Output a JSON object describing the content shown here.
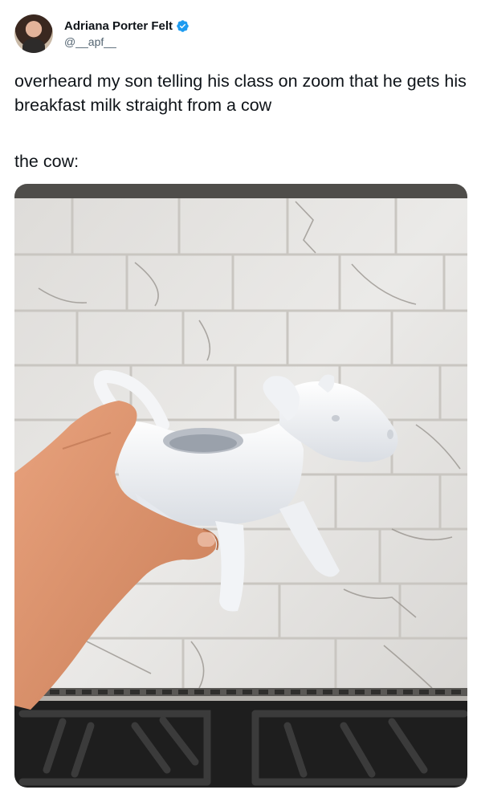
{
  "author": {
    "display_name": "Adriana Porter Felt",
    "handle": "@__apf__",
    "verified": true,
    "verified_icon": "verified-badge-icon",
    "verified_color": "#1d9bf0"
  },
  "tweet": {
    "text_line1": "overheard my son telling his class on zoom that he gets his breakfast milk straight from a cow",
    "text_line2": "the cow:"
  },
  "media": {
    "alt": "photo-cow-creamer"
  }
}
